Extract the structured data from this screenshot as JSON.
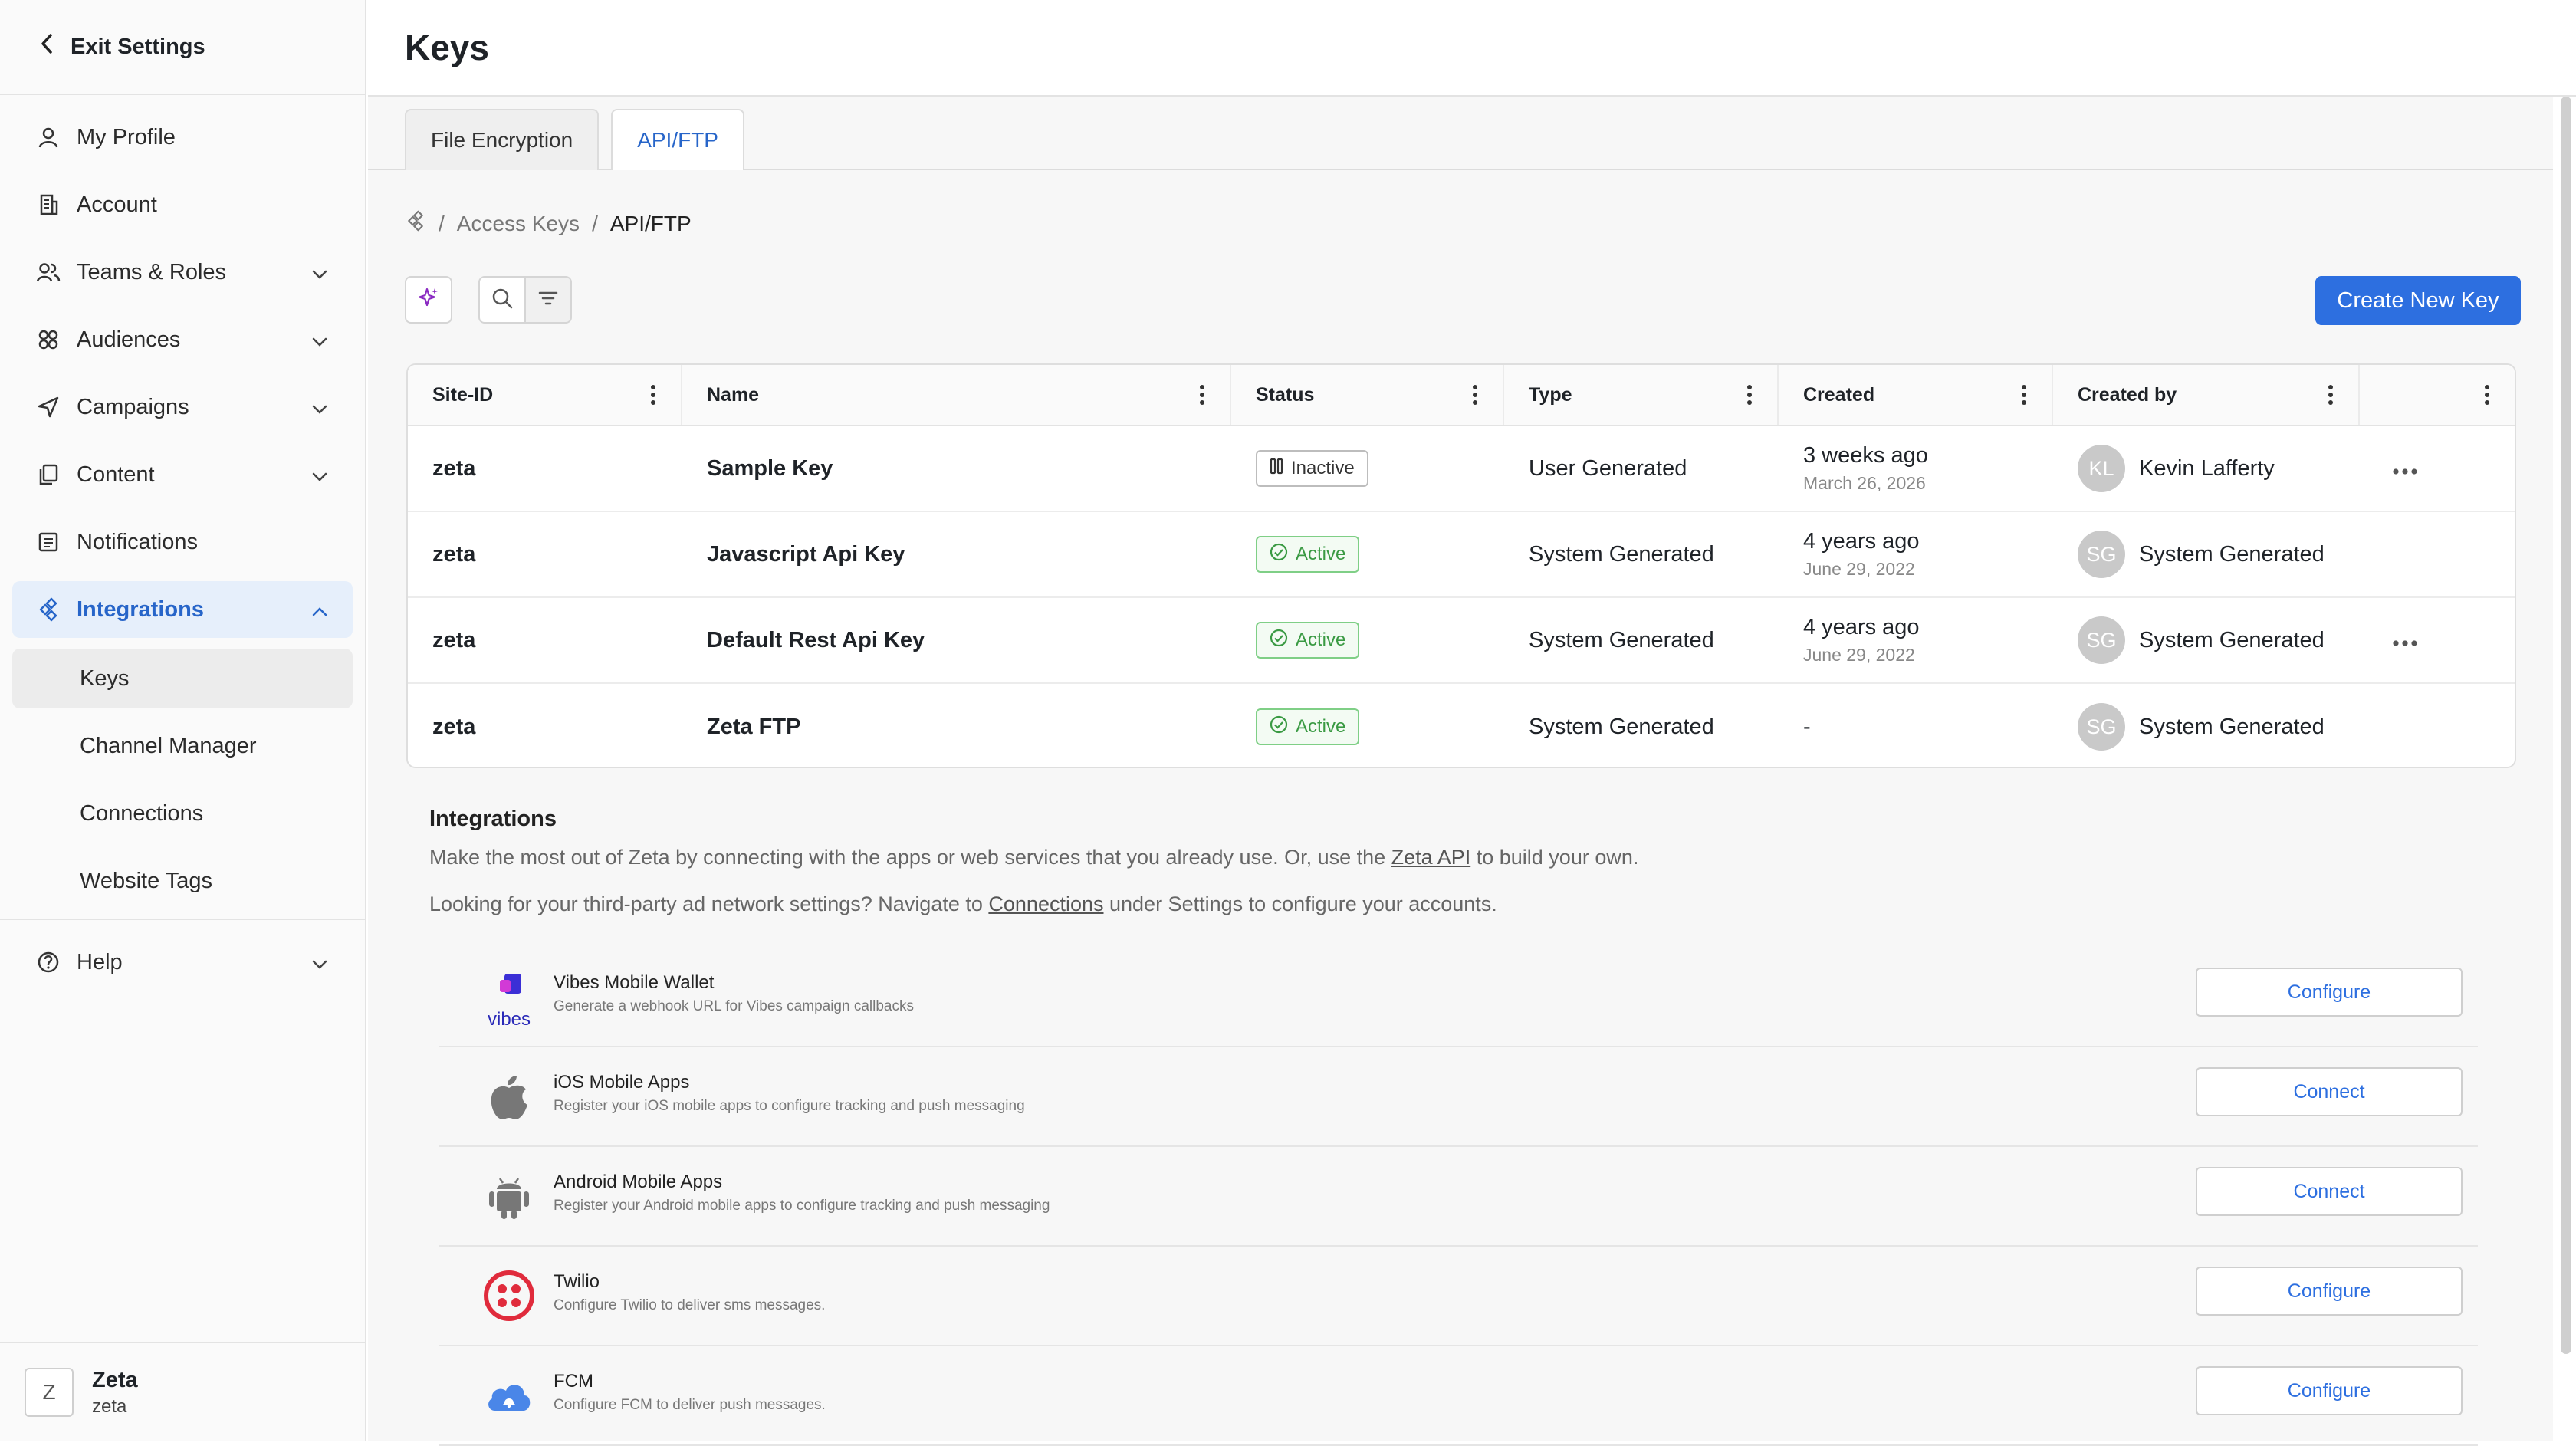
{
  "sidebar": {
    "exit_label": "Exit Settings",
    "items": [
      {
        "label": "My Profile"
      },
      {
        "label": "Account"
      },
      {
        "label": "Teams & Roles"
      },
      {
        "label": "Audiences"
      },
      {
        "label": "Campaigns"
      },
      {
        "label": "Content"
      },
      {
        "label": "Notifications"
      },
      {
        "label": "Integrations"
      }
    ],
    "sub_items": [
      {
        "label": "Keys"
      },
      {
        "label": "Channel Manager"
      },
      {
        "label": "Connections"
      },
      {
        "label": "Website Tags"
      }
    ],
    "help_label": "Help",
    "user": {
      "initial": "Z",
      "name": "Zeta",
      "sub": "zeta"
    }
  },
  "header": {
    "title": "Keys"
  },
  "tabs": [
    {
      "label": "File Encryption"
    },
    {
      "label": "API/FTP"
    }
  ],
  "breadcrumb": {
    "parent": "Access Keys",
    "current": "API/FTP"
  },
  "toolbar": {
    "create_label": "Create New Key"
  },
  "table": {
    "columns": [
      "Site-ID",
      "Name",
      "Status",
      "Type",
      "Created",
      "Created by"
    ],
    "rows": [
      {
        "site": "zeta",
        "name": "Sample Key",
        "status": "Inactive",
        "type": "User Generated",
        "created": "3 weeks ago",
        "created_date": "March 26, 2026",
        "initials": "KL",
        "created_by": "Kevin Lafferty"
      },
      {
        "site": "zeta",
        "name": "Javascript Api Key",
        "status": "Active",
        "type": "System Generated",
        "created": "4 years ago",
        "created_date": "June 29, 2022",
        "initials": "SG",
        "created_by": "System Generated"
      },
      {
        "site": "zeta",
        "name": "Default Rest Api Key",
        "status": "Active",
        "type": "System Generated",
        "created": "4 years ago",
        "created_date": "June 29, 2022",
        "initials": "SG",
        "created_by": "System Generated"
      },
      {
        "site": "zeta",
        "name": "Zeta FTP",
        "status": "Active",
        "type": "System Generated",
        "created": "-",
        "created_date": "",
        "initials": "SG",
        "created_by": "System Generated"
      }
    ]
  },
  "integrations": {
    "heading": "Integrations",
    "line1_pre": "Make the most out of Zeta by connecting with the apps or web services that you already use. Or, use the ",
    "line1_link": "Zeta API",
    "line1_post": " to build your own.",
    "line2_pre": "Looking for your third-party ad network settings? Navigate to ",
    "line2_link": "Connections",
    "line2_post": " under Settings to configure your accounts.",
    "items": [
      {
        "title": "Vibes Mobile Wallet",
        "desc": "Generate a webhook URL for Vibes campaign callbacks",
        "button": "Configure",
        "logo_text": "vibes"
      },
      {
        "title": "iOS Mobile Apps",
        "desc": "Register your iOS mobile apps to configure tracking and push messaging",
        "button": "Connect"
      },
      {
        "title": "Android Mobile Apps",
        "desc": "Register your Android mobile apps to configure tracking and push messaging",
        "button": "Connect"
      },
      {
        "title": "Twilio",
        "desc": "Configure Twilio to deliver sms messages.",
        "button": "Configure"
      },
      {
        "title": "FCM",
        "desc": "Configure FCM to deliver push messages.",
        "button": "Configure"
      }
    ]
  },
  "colors": {
    "accent": "#2d6fe0",
    "active_green": "#3a9a43",
    "sidebar_active_bg": "#e6effb"
  }
}
